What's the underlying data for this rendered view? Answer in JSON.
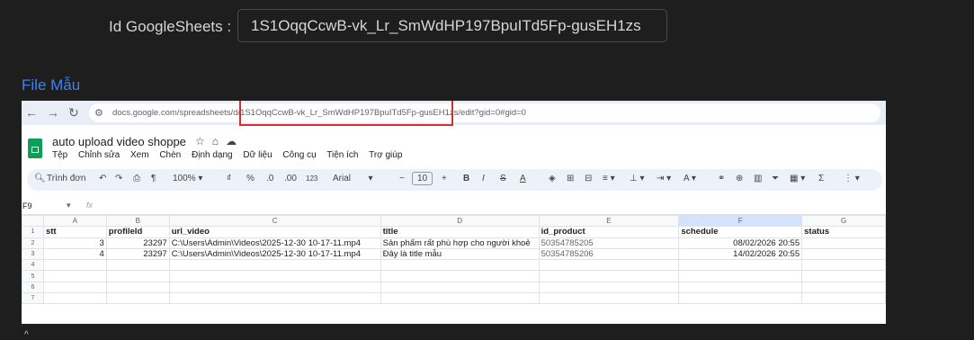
{
  "form": {
    "id_label": "Id GoogleSheets :",
    "id_value": "1S1OqqCcwB-vk_Lr_SmWdHP197BpuITd5Fp-gusEH1zs",
    "file_link": "File Mẫu"
  },
  "screenshot": {
    "browser": {
      "back_icon": "arrow-left-icon",
      "forward_icon": "arrow-right-icon",
      "reload_icon": "reload-icon",
      "url_prefix": "docs.google.com/spreadsheets/d/",
      "url_id": "1S1OqqCcwB-vk_Lr_SmWdHP197BpuITd5Fp-gusEH1zs",
      "url_suffix": "/edit?gid=0#gid=0",
      "highlight_color": "#d32f2f"
    },
    "doc": {
      "title": "auto upload video shoppe",
      "menu": [
        "Tệp",
        "Chỉnh sửa",
        "Xem",
        "Chèn",
        "Định dạng",
        "Dữ liệu",
        "Công cụ",
        "Tiện ích",
        "Trợ giúp"
      ]
    },
    "toolbar": {
      "search": "Trình đơn",
      "zoom": "100%",
      "currency": "₫",
      "percent": "%",
      "dec_dec": ".0",
      "dec_inc": ".00",
      "num_fmt": "123",
      "font": "Arial",
      "font_size": "10"
    },
    "formula_bar": {
      "cell_ref": "F9",
      "fx": "fx"
    },
    "grid": {
      "columns": [
        "A",
        "B",
        "C",
        "D",
        "E",
        "F",
        "G"
      ],
      "row_numbers": [
        "1",
        "2",
        "3",
        "4",
        "5",
        "6",
        "7"
      ],
      "header": {
        "stt": "stt",
        "profileId": "profileId",
        "url_video": "url_video",
        "title": "title",
        "id_product": "id_product",
        "schedule": "schedule",
        "status": "status"
      },
      "rows": [
        {
          "stt": "3",
          "profileId": "23297",
          "url_video": "C:\\Users\\Admin\\Videos\\2025-12-30 10-17-11.mp4",
          "title": "Sản phẩm rất phù hợp cho người khoẻ",
          "id_product": "50354785205",
          "schedule": "08/02/2026 20:55",
          "status": ""
        },
        {
          "stt": "4",
          "profileId": "23297",
          "url_video": "C:\\Users\\Admin\\Videos\\2025-12-30 10-17-11.mp4",
          "title": "Đây là title mẫu",
          "id_product": "50354785206",
          "schedule": "14/02/2026 20:55",
          "status": ""
        }
      ]
    }
  }
}
